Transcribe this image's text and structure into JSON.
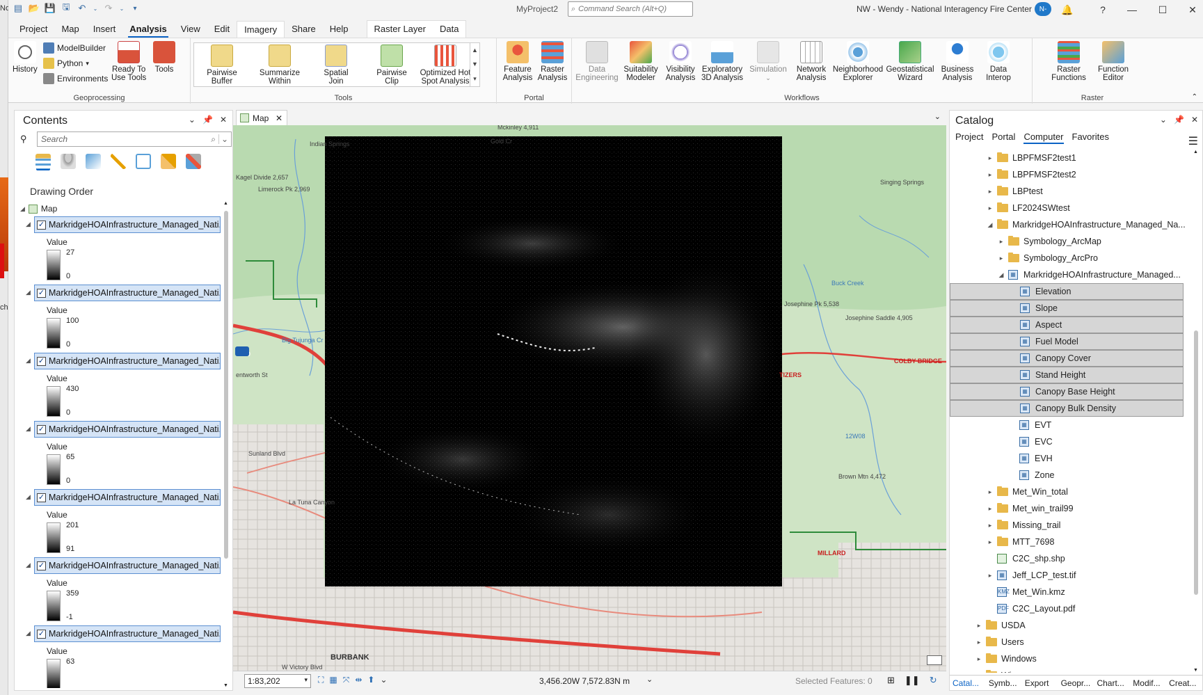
{
  "title_bar": {
    "project": "MyProject2",
    "command_search_placeholder": "Command Search (Alt+Q)",
    "account": "NW - Wendy - National Interagency Fire Center",
    "avatar_initials": "N-"
  },
  "side_fragments": [
    "No",
    "ch"
  ],
  "ribbon_tabs": [
    "Project",
    "Map",
    "Insert",
    "Analysis",
    "View",
    "Edit",
    "Imagery",
    "Share",
    "Help"
  ],
  "active_tab": "Analysis",
  "contextual_tabs": [
    "Raster Layer",
    "Data"
  ],
  "ribbon": {
    "geoprocessing": {
      "label": "Geoprocessing",
      "history": "History",
      "modelbuilder": "ModelBuilder",
      "python": "Python",
      "environments": "Environments",
      "ready_tools": [
        "Ready To",
        "Use Tools"
      ],
      "tools": "Tools"
    },
    "tools_group": {
      "label": "Tools",
      "items": [
        [
          "Pairwise",
          "Buffer"
        ],
        [
          "Summarize",
          "Within"
        ],
        [
          "Spatial",
          "Join"
        ],
        [
          "Pairwise",
          "Clip"
        ],
        [
          "Optimized Hot",
          "Spot Analysis"
        ]
      ]
    },
    "portal": {
      "label": "Portal",
      "items": [
        [
          "Feature",
          "Analysis"
        ],
        [
          "Raster",
          "Analysis"
        ]
      ]
    },
    "workflows": {
      "label": "Workflows",
      "items": [
        [
          "Data",
          "Engineering"
        ],
        [
          "Suitability",
          "Modeler"
        ],
        [
          "Visibility",
          "Analysis"
        ],
        [
          "Exploratory",
          "3D Analysis"
        ],
        [
          "Simulation",
          ""
        ],
        [
          "Network",
          "Analysis"
        ],
        [
          "Neighborhood",
          "Explorer"
        ],
        [
          "Geostatistical",
          "Wizard"
        ],
        [
          "Business",
          "Analysis"
        ],
        [
          "Data",
          "Interop"
        ]
      ]
    },
    "raster": {
      "label": "Raster",
      "items": [
        [
          "Raster",
          "Functions"
        ],
        [
          "Function",
          "Editor"
        ]
      ]
    }
  },
  "contents": {
    "title": "Contents",
    "search_placeholder": "Search",
    "drawing_order": "Drawing Order",
    "map_label": "Map",
    "layers": [
      {
        "name": "MarkridgeHOAInfrastructure_Managed_Nati...",
        "value_label": "Value",
        "high": "27",
        "low": "0"
      },
      {
        "name": "MarkridgeHOAInfrastructure_Managed_Nati...",
        "value_label": "Value",
        "high": "100",
        "low": "0"
      },
      {
        "name": "MarkridgeHOAInfrastructure_Managed_Nati...",
        "value_label": "Value",
        "high": "430",
        "low": "0"
      },
      {
        "name": "MarkridgeHOAInfrastructure_Managed_Nati...",
        "value_label": "Value",
        "high": "65",
        "low": "0"
      },
      {
        "name": "MarkridgeHOAInfrastructure_Managed_Nati...",
        "value_label": "Value",
        "high": "201",
        "low": "91"
      },
      {
        "name": "MarkridgeHOAInfrastructure_Managed_Nati...",
        "value_label": "Value",
        "high": "359",
        "low": "-1"
      },
      {
        "name": "MarkridgeHOAInfrastructure_Managed_Nati...",
        "value_label": "Value",
        "high": "63",
        "low": ""
      }
    ]
  },
  "map_view": {
    "tab_label": "Map",
    "scale": "1:83,202",
    "coordinates": "3,456.20W 7,572.83N m",
    "selected_features": "Selected Features: 0",
    "map_labels": {
      "indian_springs": "Indian Springs",
      "kagel": "Kagel Divide 2,657",
      "limerock": "Limerock Pk 2,969",
      "mckinley": "Mckinley 4,911",
      "gold": "Gold Cr",
      "singing": "Singing Springs",
      "josephine_pk": "Josephine Pk 5,538",
      "josephine_saddle": "Josephine Saddle 4,905",
      "colby": "COLBY BRIDGE",
      "tizers": "TIZERS",
      "brown": "Brown Mtn 4,472",
      "millard": "MILLARD",
      "burbank": "BURBANK",
      "road210": "210",
      "sunland": "Sunland Blvd",
      "latuna": "La Tuna Canyon",
      "victory": "W Victory Blvd",
      "tujunga": "Big Tujunga Cr",
      "buck": "Buck Creek",
      "route": "12W08",
      "wentworth": "entworth St"
    }
  },
  "catalog": {
    "title": "Catalog",
    "tabs": [
      "Project",
      "Portal",
      "Computer",
      "Favorites"
    ],
    "active_tab": "Computer",
    "items": [
      {
        "label": "LBPFMSF2test1",
        "indent": 4,
        "type": "folder",
        "arrow": "›"
      },
      {
        "label": "LBPFMSF2test2",
        "indent": 4,
        "type": "folder",
        "arrow": "›"
      },
      {
        "label": "LBPtest",
        "indent": 4,
        "type": "folder",
        "arrow": "›"
      },
      {
        "label": "LF2024SWtest",
        "indent": 4,
        "type": "folder",
        "arrow": "›"
      },
      {
        "label": "MarkridgeHOAInfrastructure_Managed_Na...",
        "indent": 4,
        "type": "folder",
        "arrow": "⌄"
      },
      {
        "label": "Symbology_ArcMap",
        "indent": 5,
        "type": "folder",
        "arrow": "›"
      },
      {
        "label": "Symbology_ArcPro",
        "indent": 5,
        "type": "folder",
        "arrow": "›"
      },
      {
        "label": "MarkridgeHOAInfrastructure_Managed...",
        "indent": 5,
        "type": "raster",
        "arrow": "⌄"
      },
      {
        "label": "Elevation",
        "indent": 6,
        "type": "raster",
        "arrow": "",
        "selected": true
      },
      {
        "label": "Slope",
        "indent": 6,
        "type": "raster",
        "arrow": "",
        "selected": true
      },
      {
        "label": "Aspect",
        "indent": 6,
        "type": "raster",
        "arrow": "",
        "selected": true
      },
      {
        "label": "Fuel Model",
        "indent": 6,
        "type": "raster",
        "arrow": "",
        "selected": true
      },
      {
        "label": "Canopy Cover",
        "indent": 6,
        "type": "raster",
        "arrow": "",
        "selected": true
      },
      {
        "label": "Stand Height",
        "indent": 6,
        "type": "raster",
        "arrow": "",
        "selected": true
      },
      {
        "label": "Canopy Base Height",
        "indent": 6,
        "type": "raster",
        "arrow": "",
        "selected": true
      },
      {
        "label": "Canopy Bulk Density",
        "indent": 6,
        "type": "raster",
        "arrow": "",
        "selected": true
      },
      {
        "label": "EVT",
        "indent": 6,
        "type": "raster",
        "arrow": ""
      },
      {
        "label": "EVC",
        "indent": 6,
        "type": "raster",
        "arrow": ""
      },
      {
        "label": "EVH",
        "indent": 6,
        "type": "raster",
        "arrow": ""
      },
      {
        "label": "Zone",
        "indent": 6,
        "type": "raster",
        "arrow": ""
      },
      {
        "label": "Met_Win_total",
        "indent": 4,
        "type": "folder",
        "arrow": "›"
      },
      {
        "label": "Met_win_trail99",
        "indent": 4,
        "type": "folder",
        "arrow": "›"
      },
      {
        "label": "Missing_trail",
        "indent": 4,
        "type": "folder",
        "arrow": "›"
      },
      {
        "label": "MTT_7698",
        "indent": 4,
        "type": "folder",
        "arrow": "›"
      },
      {
        "label": "C2C_shp.shp",
        "indent": 4,
        "type": "shp",
        "arrow": ""
      },
      {
        "label": "Jeff_LCP_test.tif",
        "indent": 4,
        "type": "raster",
        "arrow": "›"
      },
      {
        "label": "Met_Win.kmz",
        "indent": 4,
        "type": "kmz",
        "arrow": ""
      },
      {
        "label": "C2C_Layout.pdf",
        "indent": 4,
        "type": "pdf",
        "arrow": ""
      },
      {
        "label": "USDA",
        "indent": 3,
        "type": "folder",
        "arrow": "›"
      },
      {
        "label": "Users",
        "indent": 3,
        "type": "folder",
        "arrow": "›"
      },
      {
        "label": "Windows",
        "indent": 3,
        "type": "folder",
        "arrow": "›"
      },
      {
        "label": "Wi...",
        "indent": 3,
        "type": "folder",
        "arrow": "›"
      }
    ],
    "bottom_tabs": [
      "Catal...",
      "Symb...",
      "Export",
      "Geopr...",
      "Chart...",
      "Modif...",
      "Creat..."
    ]
  }
}
